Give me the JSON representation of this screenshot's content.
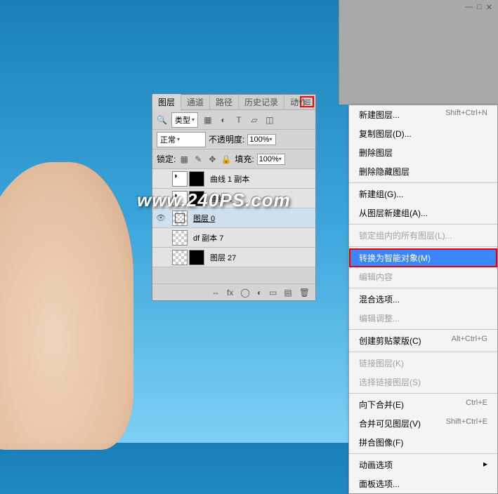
{
  "watermark": "www.240PS.com",
  "panel": {
    "tab_layers": "图层",
    "tab_channels": "通道",
    "tab_paths": "路径",
    "tab_history": "历史记录",
    "tab_actions": "动作",
    "type_label": "类型",
    "mode": "正常",
    "opacity_label": "不透明度:",
    "opacity_value": "100%",
    "lock_label": "锁定:",
    "fill_label": "填充:",
    "fill_value": "100%",
    "layers": [
      {
        "name": "曲线 1 副本"
      },
      {
        "name": "曲线 1"
      },
      {
        "name": "图层 0"
      },
      {
        "name": "df 副本 7"
      },
      {
        "name": "图层 27"
      }
    ]
  },
  "menu": {
    "items1": [
      {
        "label": "新建图层...",
        "shortcut": "Shift+Ctrl+N"
      },
      {
        "label": "复制图层(D)..."
      },
      {
        "label": "删除图层"
      },
      {
        "label": "删除隐藏图层"
      }
    ],
    "items2": [
      {
        "label": "新建组(G)..."
      },
      {
        "label": "从图层新建组(A)..."
      }
    ],
    "items3": [
      {
        "label": "锁定组内的所有图层(L)...",
        "disabled": true
      }
    ],
    "highlight": {
      "label": "转换为智能对象(M)"
    },
    "items4": [
      {
        "label": "编辑内容",
        "disabled": true
      }
    ],
    "items5": [
      {
        "label": "混合选项..."
      },
      {
        "label": "编辑调整...",
        "disabled": true
      }
    ],
    "items6": [
      {
        "label": "创建剪贴蒙版(C)",
        "shortcut": "Alt+Ctrl+G"
      }
    ],
    "items7": [
      {
        "label": "链接图层(K)",
        "disabled": true
      },
      {
        "label": "选择链接图层(S)",
        "disabled": true
      }
    ],
    "items8": [
      {
        "label": "向下合并(E)",
        "shortcut": "Ctrl+E"
      },
      {
        "label": "合并可见图层(V)",
        "shortcut": "Shift+Ctrl+E"
      },
      {
        "label": "拼合图像(F)"
      }
    ],
    "items9": [
      {
        "label": "动画选项"
      },
      {
        "label": "面板选项..."
      }
    ]
  }
}
